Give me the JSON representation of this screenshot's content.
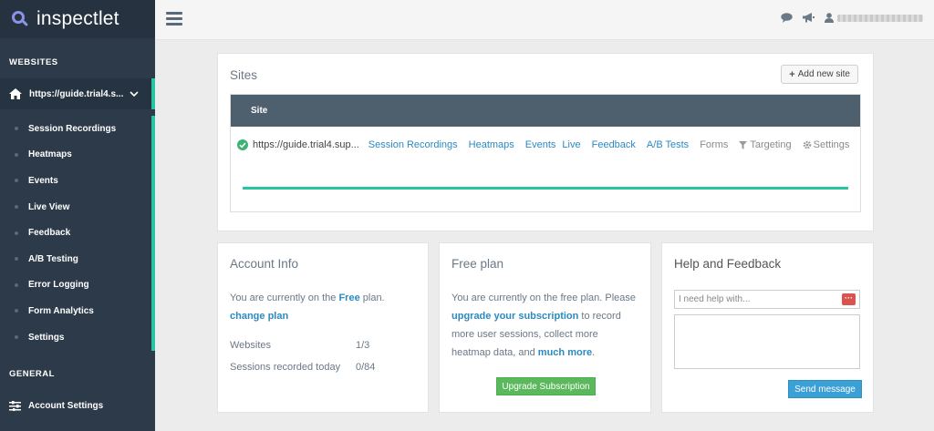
{
  "app": {
    "name": "inspectlet"
  },
  "sidebar": {
    "websites_label": "WEBSITES",
    "general_label": "GENERAL",
    "site_selector": "https://guide.trial4.s...",
    "items": [
      {
        "label": "Session Recordings"
      },
      {
        "label": "Heatmaps"
      },
      {
        "label": "Events"
      },
      {
        "label": "Live View"
      },
      {
        "label": "Feedback"
      },
      {
        "label": "A/B Testing"
      },
      {
        "label": "Error Logging"
      },
      {
        "label": "Form Analytics"
      },
      {
        "label": "Settings"
      }
    ],
    "account_settings": "Account Settings"
  },
  "topbar": {
    "icons": [
      "chat-icon",
      "megaphone-icon",
      "user-icon"
    ]
  },
  "sites": {
    "title": "Sites",
    "add_button": "Add new site",
    "column_header": "Site",
    "row": {
      "url": "https://guide.trial4.sup...",
      "links": [
        "Session Recordings",
        "Heatmaps",
        "Events",
        "Live",
        "Feedback",
        "A/B Tests"
      ],
      "forms": "Forms",
      "targeting": "Targeting",
      "settings": "Settings",
      "progress": 1.0
    }
  },
  "account_info": {
    "title": "Account Info",
    "plan_text_prefix": "You are currently on the ",
    "plan_name": "Free",
    "plan_text_suffix": " plan.",
    "change_plan": "change plan",
    "websites_label": "Websites",
    "websites_value": "1/3",
    "sessions_label": "Sessions recorded today",
    "sessions_value": "0/84"
  },
  "free_plan": {
    "title": "Free plan",
    "line1": "You are currently on the free plan. Please",
    "upgrade_link": "upgrade your subscription",
    "line2_suffix": " to record",
    "line3": "more user sessions, collect more",
    "line4_prefix": "heatmap data, and ",
    "more_link": "much more",
    "line4_suffix": ".",
    "button": "Upgrade Subscription"
  },
  "help": {
    "title": "Help and Feedback",
    "placeholder": "I need help with...",
    "send_button": "Send message"
  },
  "colors": {
    "accent": "#28c5a3",
    "sidebar": "#2c3a4a",
    "link": "#2c8ac0",
    "upgrade": "#5cb85c",
    "send": "#3aa0d5"
  }
}
